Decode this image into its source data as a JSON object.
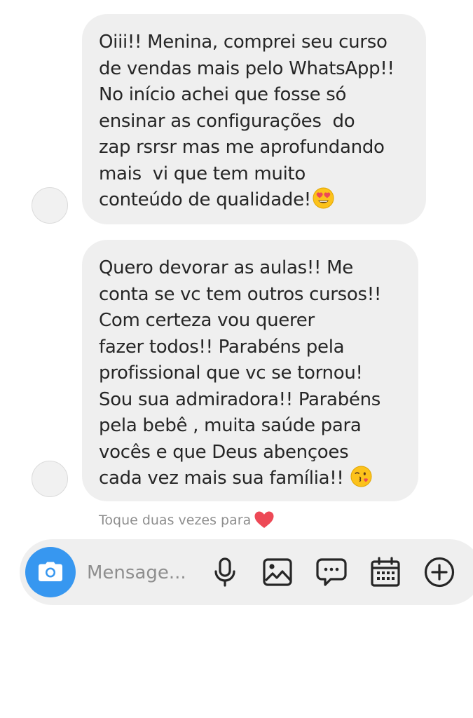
{
  "messages": [
    {
      "lines": [
        "Oiii!! Menina, comprei seu curso",
        "de vendas mais pelo WhatsApp!!",
        "No início achei que fosse só",
        "ensinar as configurações  do",
        "zap rsrsr mas me aprofundando",
        "mais  vi que tem muito",
        "conteúdo de qualidade!"
      ],
      "emoji": "heart-eyes"
    },
    {
      "lines": [
        "Quero devorar as aulas!! Me",
        "conta se vc tem outros cursos!!",
        "Com certeza vou querer",
        "fazer todos!! Parabéns pela",
        "profissional que vc se tornou!",
        "Sou sua admiradora!! Parabéns",
        "pela bebê , muita saúde para",
        "vocês e que Deus abençoes",
        "cada vez mais sua família!! "
      ],
      "emoji": "face-blowing-kiss"
    }
  ],
  "like_hint": {
    "text": "Toque duas vezes para",
    "icon": "heart-icon",
    "color": "#ed4956"
  },
  "composer": {
    "placeholder": "Mensage...",
    "value": "",
    "accent": "#3797f0",
    "icons": [
      "camera-icon",
      "microphone-icon",
      "gallery-icon",
      "chat-bubble-icon",
      "calendar-icon",
      "plus-circle-icon"
    ]
  }
}
